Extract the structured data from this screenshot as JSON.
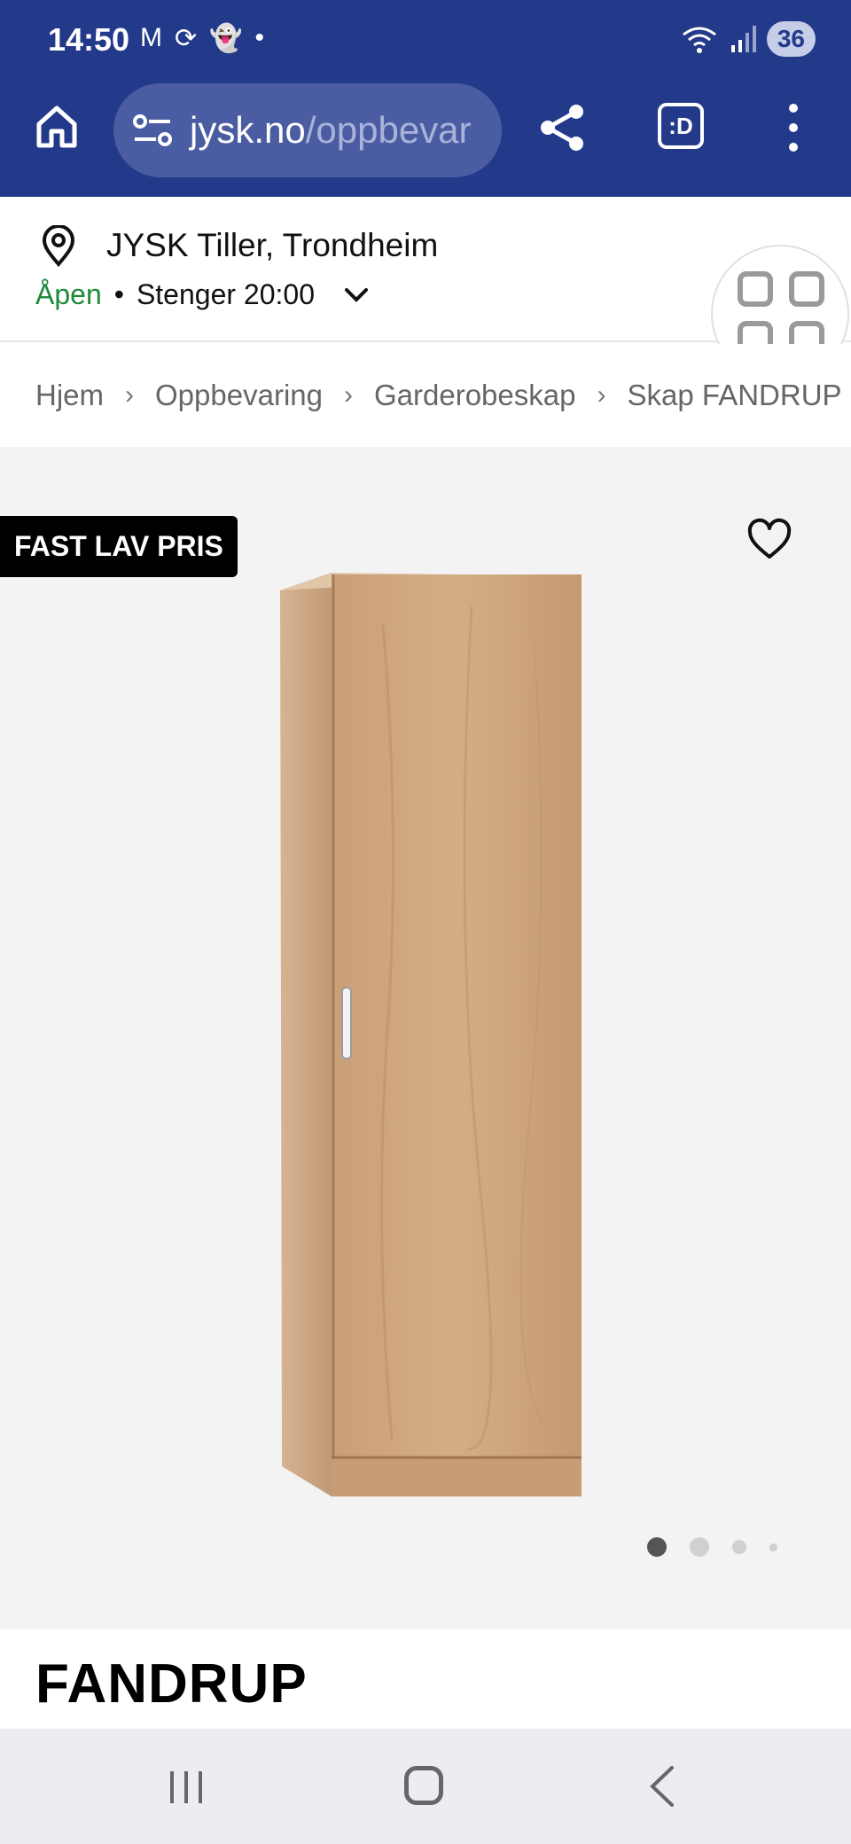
{
  "status_bar": {
    "time": "14:50",
    "notification_icons": [
      "M",
      "⟳",
      "👻",
      "•"
    ],
    "battery": "36"
  },
  "browser": {
    "url_host": "jysk.no",
    "url_path": "/oppbevar",
    "tabs_label": ":D"
  },
  "store": {
    "name": "JYSK Tiller, Trondheim",
    "open_label": "Åpen",
    "separator": "•",
    "closes": "Stenger 20:00"
  },
  "breadcrumb": {
    "items": [
      "Hjem",
      "Oppbevaring",
      "Garderobeskap",
      "Skap FANDRUP"
    ],
    "separator": "›"
  },
  "product": {
    "badge": "FAST LAV PRIS",
    "title": "FANDRUP",
    "image_count": 4,
    "active_image": 1
  },
  "colors": {
    "chrome": "#233a8b",
    "open": "#1f8a3a",
    "wood": "#c9a07a"
  }
}
